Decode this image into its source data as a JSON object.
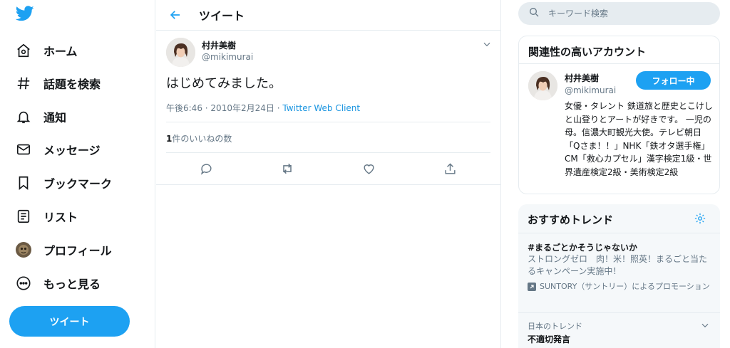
{
  "colors": {
    "accent": "#1da1f2",
    "text": "#14171a",
    "secondary": "#657786",
    "border": "#e6ecf0"
  },
  "nav": {
    "logo_icon": "twitter-bird-icon",
    "items": [
      {
        "label": "ホーム",
        "icon": "home-icon"
      },
      {
        "label": "話題を検索",
        "icon": "hashtag-icon"
      },
      {
        "label": "通知",
        "icon": "bell-icon"
      },
      {
        "label": "メッセージ",
        "icon": "envelope-icon"
      },
      {
        "label": "ブックマーク",
        "icon": "bookmark-icon"
      },
      {
        "label": "リスト",
        "icon": "list-icon"
      },
      {
        "label": "プロフィール",
        "icon": "profile-avatar-icon"
      },
      {
        "label": "もっと見る",
        "icon": "more-circle-icon"
      }
    ],
    "tweet_button": "ツイート"
  },
  "header": {
    "title": "ツイート"
  },
  "tweet": {
    "name": "村井美樹",
    "handle": "@mikimurai",
    "text": "はじめてみました。",
    "time": "午後6:46",
    "date": "2010年2月24日",
    "source": "Twitter Web Client",
    "likes_count": "1",
    "likes_label": "件のいいねの数"
  },
  "search": {
    "placeholder": "キーワード検索"
  },
  "related": {
    "title": "関連性の高いアカウント",
    "name": "村井美樹",
    "handle": "@mikimurai",
    "follow_label": "フォロー中",
    "bio": "女優・タレント 鉄道旅と歴史とこけしと山登りとアートが好きです。 一児の母。信濃大町観光大使。テレビ朝日「Qさま！！」NHK「鉄オタ選手権」CM「救心カプセル」漢字検定1級・世界遺産検定2級・美術検定2級"
  },
  "trends": {
    "title": "おすすめトレンド",
    "item1": {
      "name": "#まるごとかそうじゃないか",
      "desc": "ストロングゼロ　肉！米！照英！まるごと当たるキャンペーン実施中！",
      "promo": "SUNTORY（サントリー）によるプロモーション"
    },
    "item2": {
      "category": "日本のトレンド",
      "name": "不適切発言"
    }
  }
}
